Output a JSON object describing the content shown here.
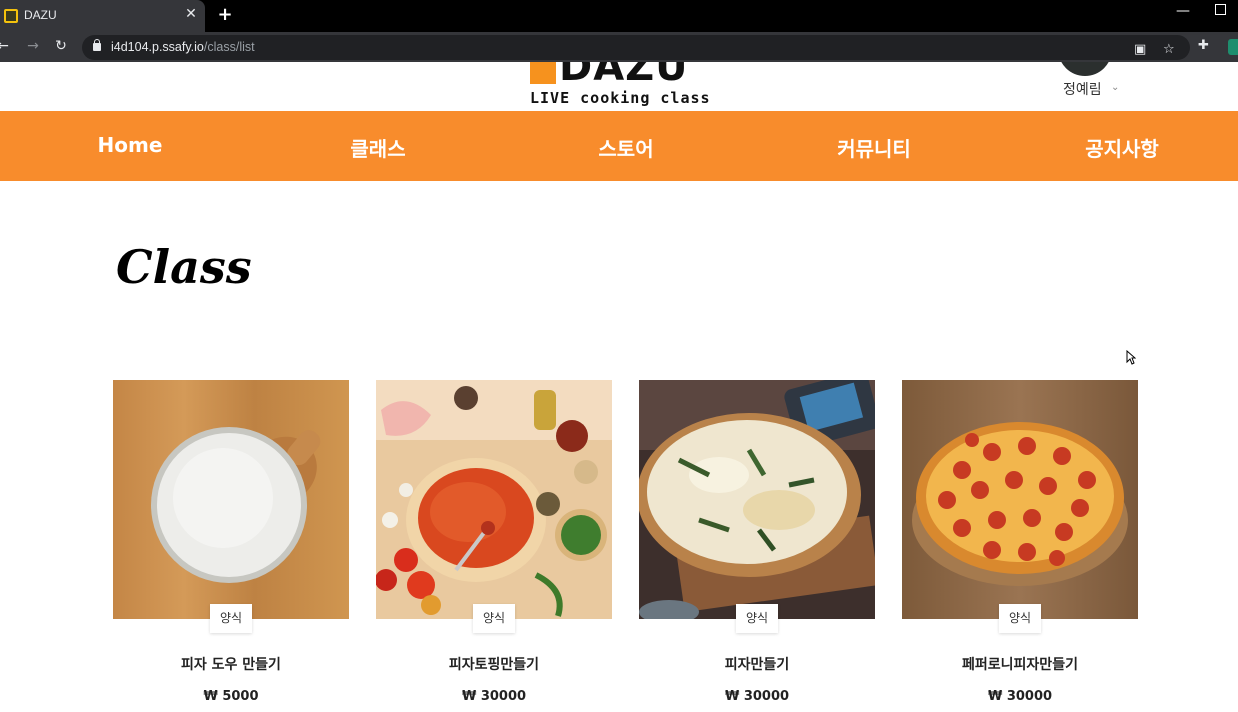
{
  "browser": {
    "tab_title": "DAZU",
    "url_host": "i4d104.p.ssafy.io",
    "url_path": "/class/list"
  },
  "header": {
    "logo_text": "DAZU",
    "logo_sub": "LIVE cooking class",
    "user_name": "정예림"
  },
  "nav": {
    "items": [
      "Home",
      "클래스",
      "스토어",
      "커뮤니티",
      "공지사항"
    ]
  },
  "page": {
    "title": "Class"
  },
  "classes": [
    {
      "tag": "양식",
      "name": "피자 도우 만들기",
      "price": "₩ 5000"
    },
    {
      "tag": "양식",
      "name": "피자토핑만들기",
      "price": "₩ 30000"
    },
    {
      "tag": "양식",
      "name": "피자만들기",
      "price": "₩ 30000"
    },
    {
      "tag": "양식",
      "name": "페퍼로니피자만들기",
      "price": "₩ 30000"
    }
  ],
  "colors": {
    "accent": "#f88c2c",
    "logo_orange": "#f6921e"
  }
}
